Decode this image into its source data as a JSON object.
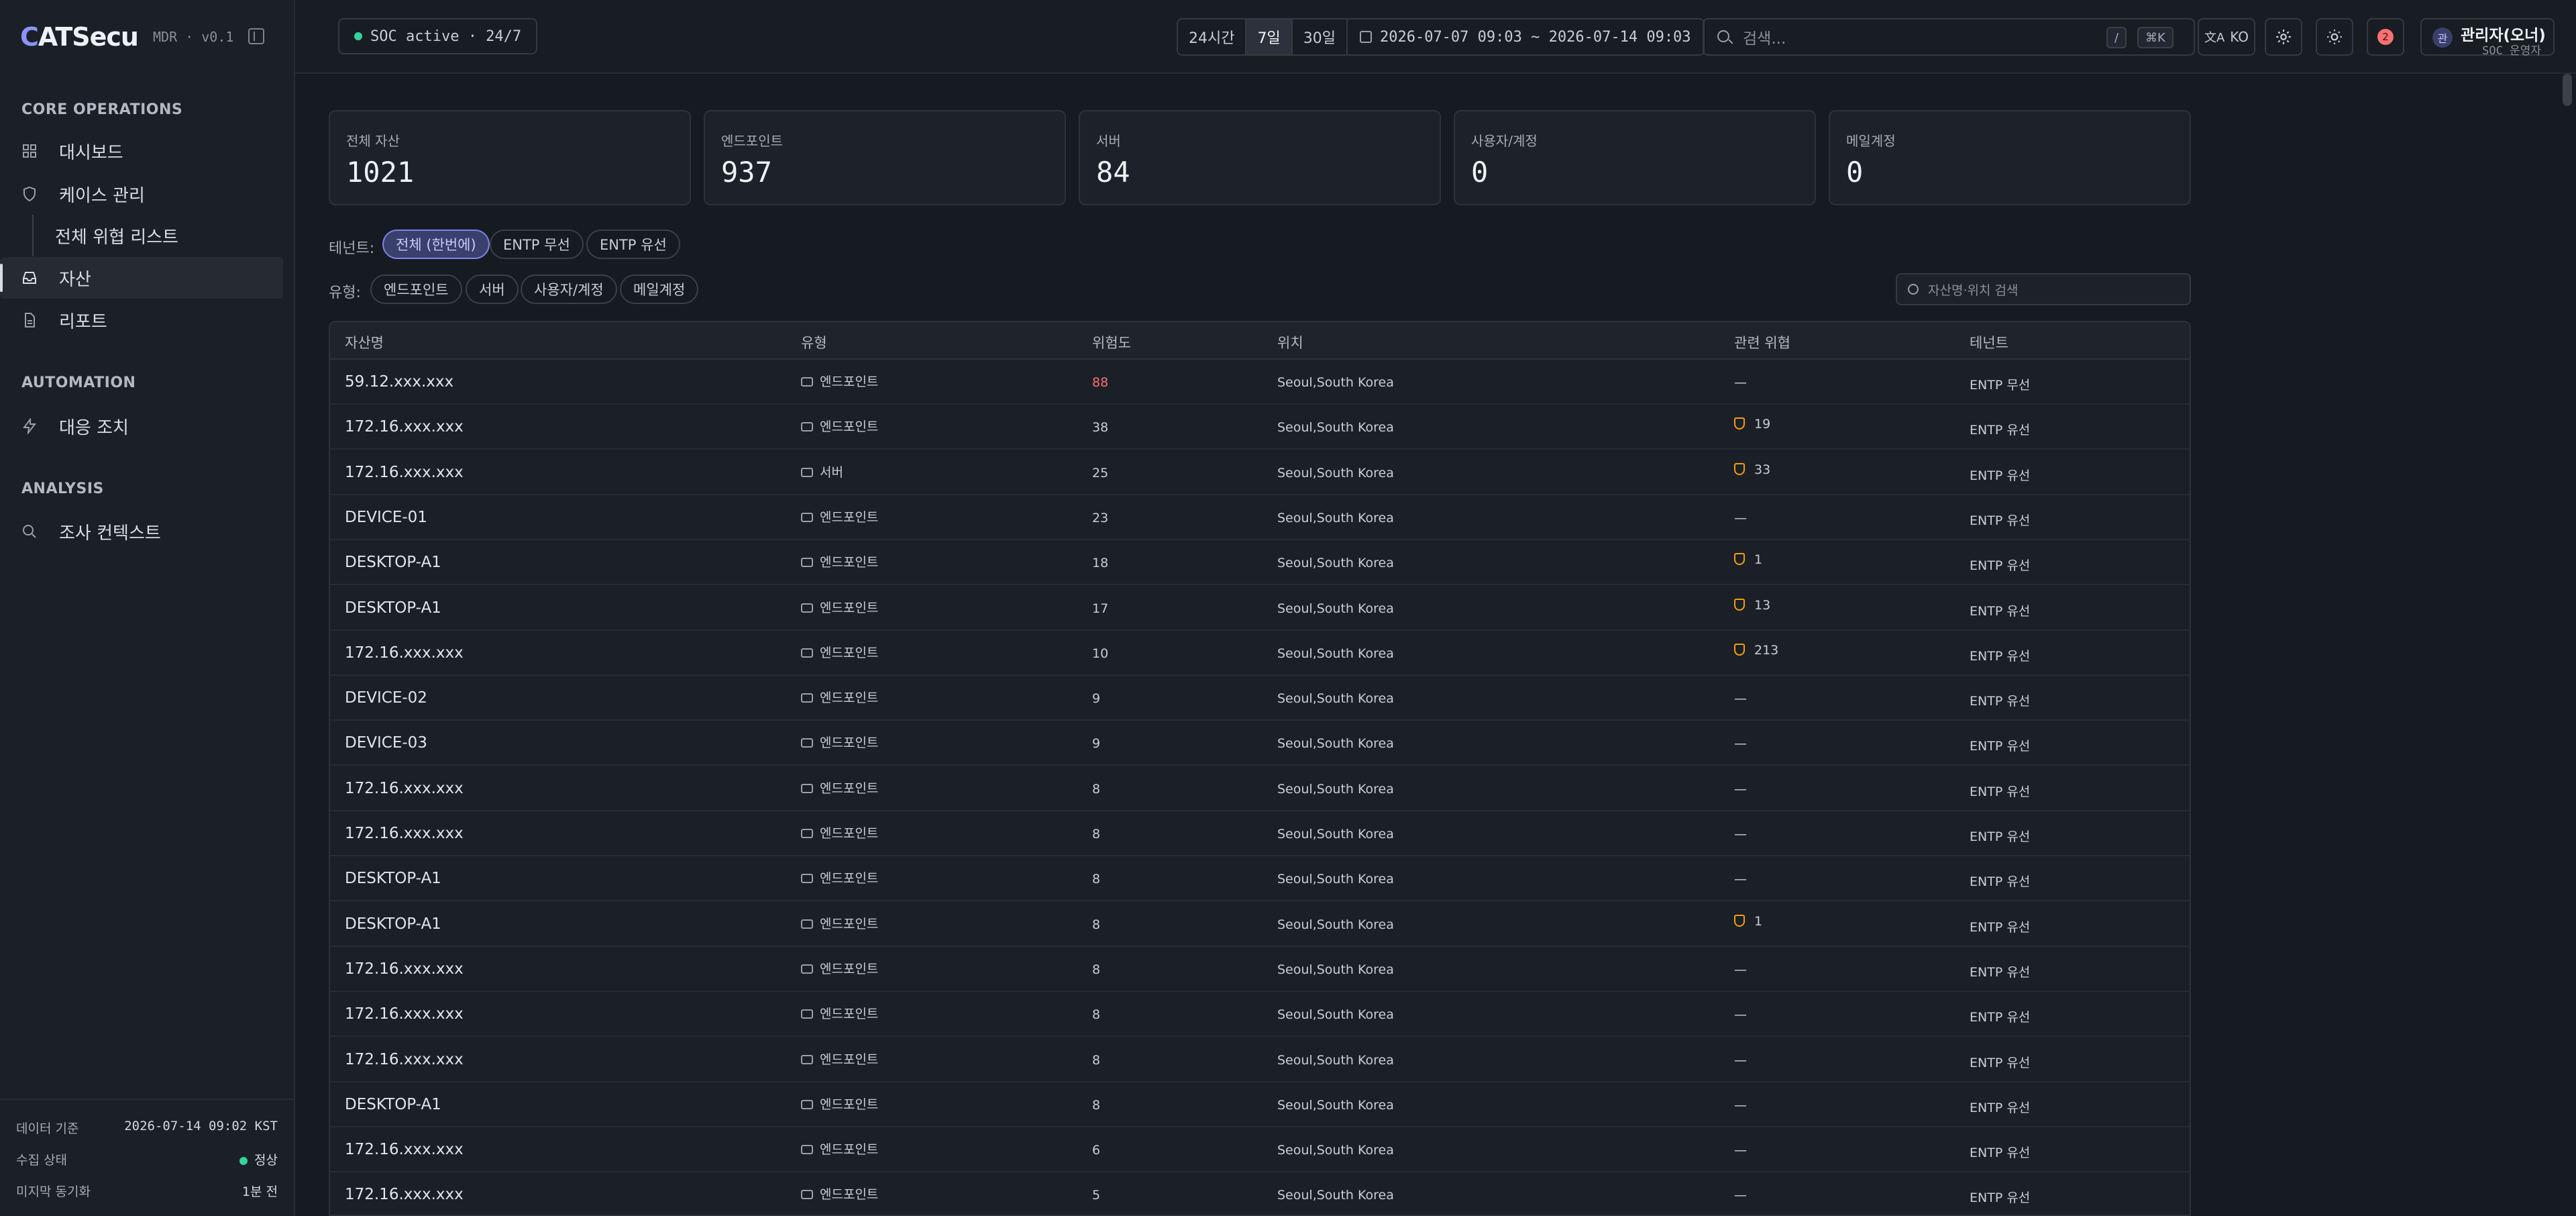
{
  "brand": {
    "name_prefix": "C",
    "name_rest": "ATSecu",
    "version": "MDR · v0.1"
  },
  "sidebar": {
    "sections": [
      "CORE OPERATIONS",
      "AUTOMATION",
      "ANALYSIS"
    ],
    "items": [
      {
        "label": "대시보드",
        "icon": "grid-icon"
      },
      {
        "label": "케이스 관리",
        "icon": "shield-icon"
      },
      {
        "label": "전체 위협 리스트",
        "icon": ""
      },
      {
        "label": "자산",
        "icon": "inbox-icon",
        "active": true
      },
      {
        "label": "리포트",
        "icon": "file-icon"
      },
      {
        "label": "대응 조치",
        "icon": "bolt-icon"
      },
      {
        "label": "조사 컨텍스트",
        "icon": "search-icon"
      }
    ],
    "footer": {
      "data_label": "데이터 기준",
      "data_value": "2026-07-14 09:02 KST",
      "collect_label": "수집 상태",
      "collect_value": "정상",
      "sync_label": "미지막 동기화",
      "sync_value": "1분 전"
    }
  },
  "topbar": {
    "soc_status": "SOC active · 24/7",
    "ranges": [
      "24시간",
      "7일",
      "30일"
    ],
    "active_range": "7일",
    "date_range": "2026-07-07 09:03 ~ 2026-07-14 09:03",
    "search_placeholder": "검색...",
    "kbd_slash": "/",
    "kbd_cmd": "⌘K",
    "lang": "KO",
    "notification_count": "2",
    "user_initial": "관",
    "user_name": "관리자(오너)",
    "user_role": "SOC 운영자"
  },
  "stats": [
    {
      "label": "전체 자산",
      "value": "1021"
    },
    {
      "label": "엔드포인트",
      "value": "937"
    },
    {
      "label": "서버",
      "value": "84"
    },
    {
      "label": "사용자/계정",
      "value": "0"
    },
    {
      "label": "메일계정",
      "value": "0"
    }
  ],
  "filters": {
    "tenant_label": "테넌트:",
    "tenants": [
      "전체 (한번에)",
      "ENTP 무선",
      "ENTP 유선"
    ],
    "type_label": "유형:",
    "types": [
      "엔드포인트",
      "서버",
      "사용자/계정",
      "메일계정"
    ],
    "asset_search_placeholder": "자산명·위치 검색"
  },
  "table": {
    "columns": [
      "자산명",
      "유형",
      "위험도",
      "위치",
      "관련 위협",
      "테넌트"
    ],
    "rows": [
      {
        "name": "59.12.xxx.xxx",
        "type": "엔드포인트",
        "risk": "88",
        "location": "Seoul,South Korea",
        "threats": "—",
        "tenant": "ENTP 무선"
      },
      {
        "name": "172.16.xxx.xxx",
        "type": "엔드포인트",
        "risk": "38",
        "location": "Seoul,South Korea",
        "threats": "19",
        "tenant": "ENTP 유선"
      },
      {
        "name": "172.16.xxx.xxx",
        "type": "서버",
        "risk": "25",
        "location": "Seoul,South Korea",
        "threats": "33",
        "tenant": "ENTP 유선"
      },
      {
        "name": "DEVICE-01",
        "type": "엔드포인트",
        "risk": "23",
        "location": "Seoul,South Korea",
        "threats": "—",
        "tenant": "ENTP 유선"
      },
      {
        "name": "DESKTOP-A1",
        "type": "엔드포인트",
        "risk": "18",
        "location": "Seoul,South Korea",
        "threats": "1",
        "tenant": "ENTP 유선"
      },
      {
        "name": "DESKTOP-A1",
        "type": "엔드포인트",
        "risk": "17",
        "location": "Seoul,South Korea",
        "threats": "13",
        "tenant": "ENTP 유선"
      },
      {
        "name": "172.16.xxx.xxx",
        "type": "엔드포인트",
        "risk": "10",
        "location": "Seoul,South Korea",
        "threats": "213",
        "tenant": "ENTP 유선"
      },
      {
        "name": "DEVICE-02",
        "type": "엔드포인트",
        "risk": "9",
        "location": "Seoul,South Korea",
        "threats": "—",
        "tenant": "ENTP 유선"
      },
      {
        "name": "DEVICE-03",
        "type": "엔드포인트",
        "risk": "9",
        "location": "Seoul,South Korea",
        "threats": "—",
        "tenant": "ENTP 유선"
      },
      {
        "name": "172.16.xxx.xxx",
        "type": "엔드포인트",
        "risk": "8",
        "location": "Seoul,South Korea",
        "threats": "—",
        "tenant": "ENTP 유선"
      },
      {
        "name": "172.16.xxx.xxx",
        "type": "엔드포인트",
        "risk": "8",
        "location": "Seoul,South Korea",
        "threats": "—",
        "tenant": "ENTP 유선"
      },
      {
        "name": "DESKTOP-A1",
        "type": "엔드포인트",
        "risk": "8",
        "location": "Seoul,South Korea",
        "threats": "—",
        "tenant": "ENTP 유선"
      },
      {
        "name": "DESKTOP-A1",
        "type": "엔드포인트",
        "risk": "8",
        "location": "Seoul,South Korea",
        "threats": "1",
        "tenant": "ENTP 유선"
      },
      {
        "name": "172.16.xxx.xxx",
        "type": "엔드포인트",
        "risk": "8",
        "location": "Seoul,South Korea",
        "threats": "—",
        "tenant": "ENTP 유선"
      },
      {
        "name": "172.16.xxx.xxx",
        "type": "엔드포인트",
        "risk": "8",
        "location": "Seoul,South Korea",
        "threats": "—",
        "tenant": "ENTP 유선"
      },
      {
        "name": "172.16.xxx.xxx",
        "type": "엔드포인트",
        "risk": "8",
        "location": "Seoul,South Korea",
        "threats": "—",
        "tenant": "ENTP 유선"
      },
      {
        "name": "DESKTOP-A1",
        "type": "엔드포인트",
        "risk": "8",
        "location": "Seoul,South Korea",
        "threats": "—",
        "tenant": "ENTP 유선"
      },
      {
        "name": "172.16.xxx.xxx",
        "type": "엔드포인트",
        "risk": "6",
        "location": "Seoul,South Korea",
        "threats": "—",
        "tenant": "ENTP 유선"
      },
      {
        "name": "172.16.xxx.xxx",
        "type": "엔드포인트",
        "risk": "5",
        "location": "Seoul,South Korea",
        "threats": "—",
        "tenant": "ENTP 유선"
      }
    ]
  },
  "colors": {
    "accent": "#7c84f0",
    "risk_high": "#f87171",
    "threat": "#f59e0b",
    "ok": "#34d399"
  }
}
